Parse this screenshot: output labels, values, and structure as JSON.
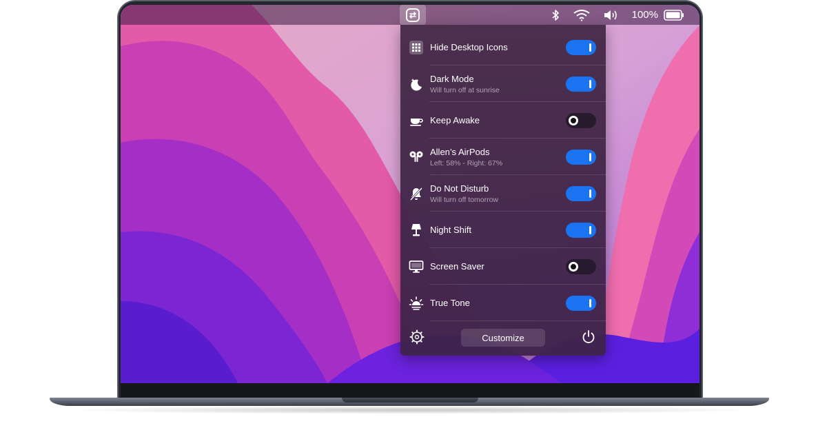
{
  "menubar": {
    "battery_percent": "100%",
    "icons": [
      "app-switch-icon",
      "bluetooth-icon",
      "wifi-icon",
      "volume-icon",
      "battery-icon"
    ]
  },
  "panel": {
    "items": [
      {
        "icon": "grid-icon",
        "title": "Hide Desktop Icons",
        "subtitle": "",
        "enabled": true
      },
      {
        "icon": "moon-icon",
        "title": "Dark Mode",
        "subtitle": "Will turn off at sunrise",
        "enabled": true
      },
      {
        "icon": "cup-icon",
        "title": "Keep Awake",
        "subtitle": "",
        "enabled": false
      },
      {
        "icon": "airpods-icon",
        "title": "Allen’s AirPods",
        "subtitle": "Left: 58% - Right: 67%",
        "enabled": true
      },
      {
        "icon": "bell-slash-icon",
        "title": "Do Not Disturb",
        "subtitle": "Will turn off tomorrow",
        "enabled": true
      },
      {
        "icon": "lamp-icon",
        "title": "Night Shift",
        "subtitle": "",
        "enabled": true
      },
      {
        "icon": "monitor-icon",
        "title": "Screen Saver",
        "subtitle": "",
        "enabled": false
      },
      {
        "icon": "sun-icon",
        "title": "True Tone",
        "subtitle": "",
        "enabled": true
      }
    ],
    "customize_label": "Customize"
  },
  "colors": {
    "toggle_on": "#1a73f0",
    "panel_bg": "#46294a"
  }
}
